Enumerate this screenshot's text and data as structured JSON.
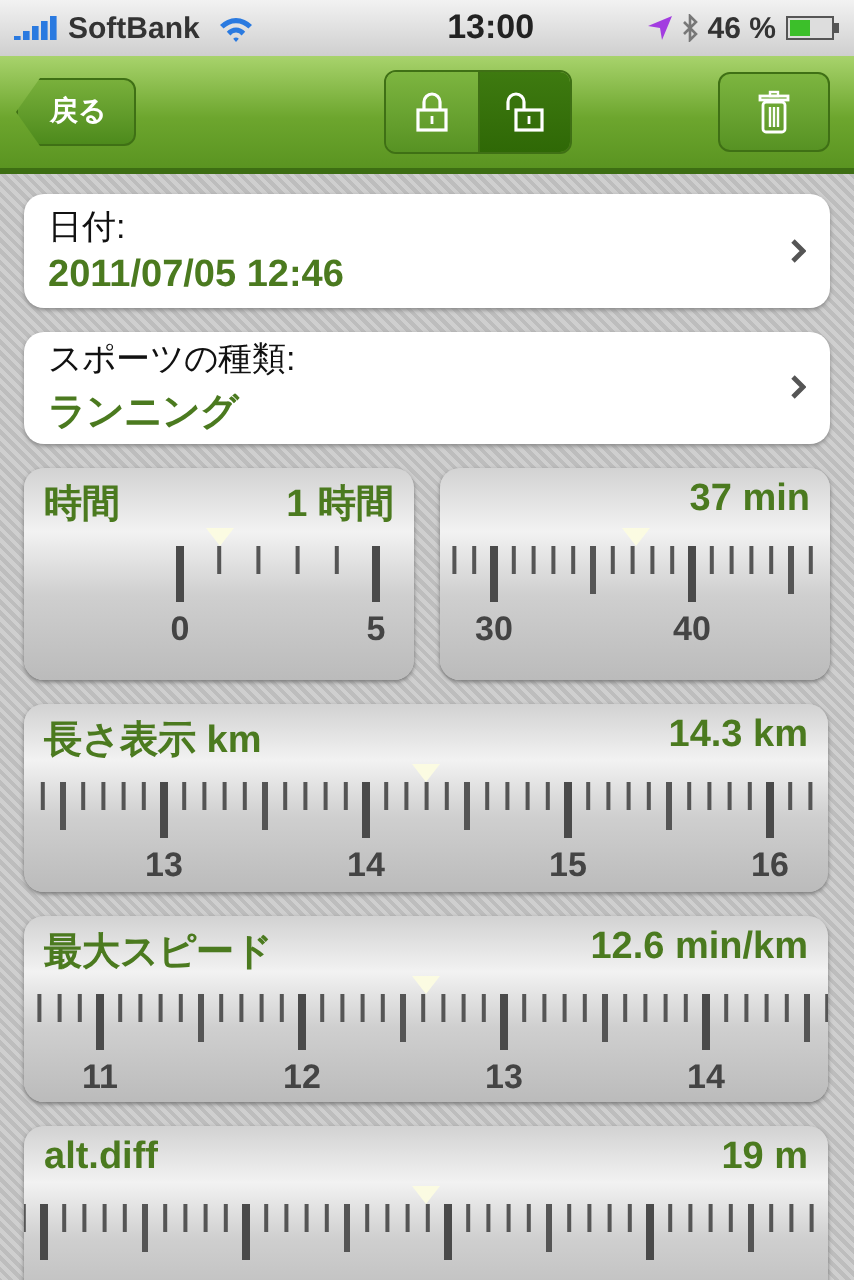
{
  "status_bar": {
    "carrier": "SoftBank",
    "time": "13:00",
    "battery": "46 %"
  },
  "nav_bar": {
    "back": "戻る",
    "lock_segments": [
      {
        "kind": "locked",
        "selected": false
      },
      {
        "kind": "unlocked",
        "selected": true
      }
    ]
  },
  "fields": [
    {
      "label": "日付:",
      "value": "2011/07/05 12:46"
    },
    {
      "label": "スポーツの種類:",
      "value": "ランニング"
    }
  ],
  "rulers": [
    {
      "kind": "coarse",
      "title": "時間",
      "reading": "1 時間",
      "scale_labels": [
        "0",
        "5"
      ]
    },
    {
      "kind": "fine",
      "reading": "37 min",
      "scale_labels": [
        "30",
        "40"
      ]
    },
    {
      "kind": "fine",
      "title": "長さ表示 km",
      "reading": "14.3 km",
      "scale_labels": [
        "13",
        "14",
        "15",
        "16"
      ]
    },
    {
      "kind": "fine",
      "title": "最大スピード",
      "reading": "12.6 min/km",
      "scale_labels": [
        "11",
        "12",
        "13",
        "14"
      ]
    },
    {
      "kind": "fine",
      "title": "alt.diff",
      "reading": "19 m"
    }
  ]
}
